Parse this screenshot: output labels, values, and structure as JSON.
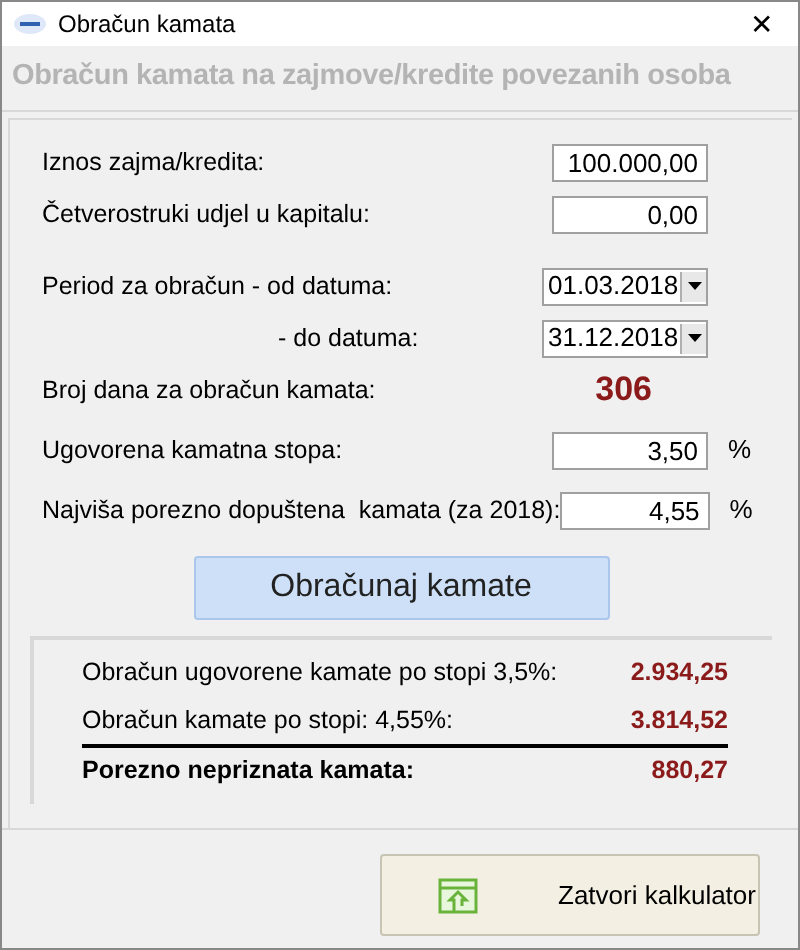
{
  "window": {
    "title": "Obračun kamata",
    "close": "✕"
  },
  "header": "Obračun kamata na zajmove/kredite povezanih osoba",
  "fields": [
    {
      "kind": "text",
      "label": "Iznos zajma/kredita:",
      "value": "100.000,00"
    },
    {
      "kind": "text",
      "label": "Četverostruki udjel u kapitalu:",
      "value": "0,00"
    },
    {
      "kind": "date",
      "label": "Period za obračun - od datuma:",
      "value": "01.03.2018"
    },
    {
      "kind": "date",
      "label": "- do datuma:",
      "value": "31.12.2018"
    },
    {
      "kind": "readout",
      "label": "Broj dana za obračun kamata:",
      "value": "306"
    },
    {
      "kind": "text",
      "label": "Ugovorena kamatna stopa:",
      "value": "3,50",
      "unit": "%"
    },
    {
      "kind": "text",
      "label": "Najviša porezno dopuštena  kamata (za 2018):",
      "value": "4,55",
      "unit": "%"
    }
  ],
  "calculate_button": "Obračunaj kamate",
  "results": [
    {
      "label": "Obračun ugovorene kamate po stopi 3,5%:",
      "value": "2.934,25",
      "total": false
    },
    {
      "label": "Obračun kamate po stopi: 4,55%:",
      "value": "3.814,52",
      "total": false
    },
    {
      "label": "Porezno nepriznata kamata:",
      "value": "880,27",
      "total": true
    }
  ],
  "close_button": "Zatvori kalkulator"
}
